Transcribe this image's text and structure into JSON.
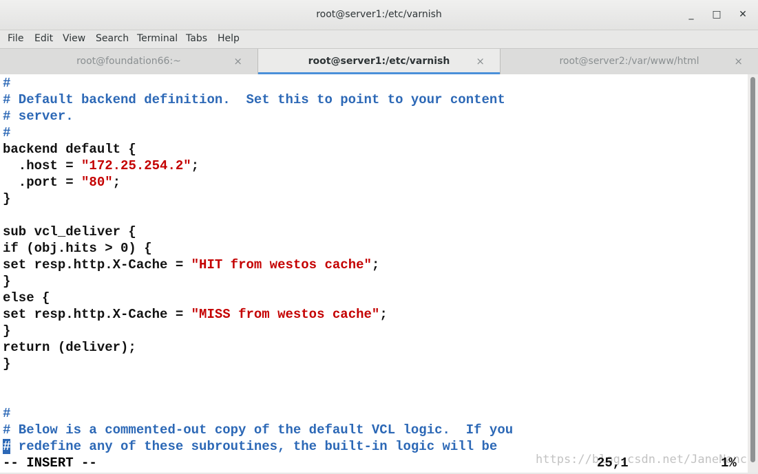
{
  "window": {
    "title": "root@server1:/etc/varnish",
    "minimize_glyph": "_",
    "maximize_glyph": "□",
    "close_glyph": "✕"
  },
  "menu": [
    "File",
    "Edit",
    "View",
    "Search",
    "Terminal",
    "Tabs",
    "Help"
  ],
  "tabs": [
    {
      "label": "root@foundation66:~",
      "close": "×"
    },
    {
      "label": "root@server1:/etc/varnish",
      "close": "×"
    },
    {
      "label": "root@server2:/var/www/html",
      "close": "×"
    }
  ],
  "editor": {
    "lines": [
      [
        {
          "t": "#",
          "k": "c"
        }
      ],
      [
        {
          "t": "# Default backend definition.  Set this to point to your content",
          "k": "c"
        }
      ],
      [
        {
          "t": "# server.",
          "k": "c"
        }
      ],
      [
        {
          "t": "#",
          "k": "c"
        }
      ],
      [
        {
          "t": "backend default {",
          "k": "n"
        }
      ],
      [
        {
          "t": "  .host = ",
          "k": "n"
        },
        {
          "t": "\"172.25.254.2\"",
          "k": "s"
        },
        {
          "t": ";",
          "k": "n"
        }
      ],
      [
        {
          "t": "  .port = ",
          "k": "n"
        },
        {
          "t": "\"80\"",
          "k": "s"
        },
        {
          "t": ";",
          "k": "n"
        }
      ],
      [
        {
          "t": "}",
          "k": "n"
        }
      ],
      [
        {
          "t": "",
          "k": "n"
        }
      ],
      [
        {
          "t": "sub vcl_deliver {",
          "k": "n"
        }
      ],
      [
        {
          "t": "if (obj.hits > 0) {",
          "k": "n"
        }
      ],
      [
        {
          "t": "set resp.http.X-Cache = ",
          "k": "n"
        },
        {
          "t": "\"HIT from westos cache\"",
          "k": "s"
        },
        {
          "t": ";",
          "k": "n"
        }
      ],
      [
        {
          "t": "}",
          "k": "n"
        }
      ],
      [
        {
          "t": "else {",
          "k": "n"
        }
      ],
      [
        {
          "t": "set resp.http.X-Cache = ",
          "k": "n"
        },
        {
          "t": "\"MISS from westos cache\"",
          "k": "s"
        },
        {
          "t": ";",
          "k": "n"
        }
      ],
      [
        {
          "t": "}",
          "k": "n"
        }
      ],
      [
        {
          "t": "return (deliver);",
          "k": "n"
        }
      ],
      [
        {
          "t": "}",
          "k": "n"
        }
      ],
      [
        {
          "t": "",
          "k": "n"
        }
      ],
      [
        {
          "t": "",
          "k": "n"
        }
      ],
      [
        {
          "t": "#",
          "k": "c"
        }
      ],
      [
        {
          "t": "# Below is a commented-out copy of the default VCL logic.  If you",
          "k": "c"
        }
      ],
      [
        {
          "t": "#",
          "k": "cursor"
        },
        {
          "t": " redefine any of these subroutines, the built-in logic will be",
          "k": "c"
        }
      ]
    ],
    "mode": "-- INSERT --",
    "cursor_position": "25,1",
    "scroll_percent": "1%",
    "scrollbar_position": 0.01
  },
  "watermark": "https://blog.csdn.net/JaneNancy"
}
